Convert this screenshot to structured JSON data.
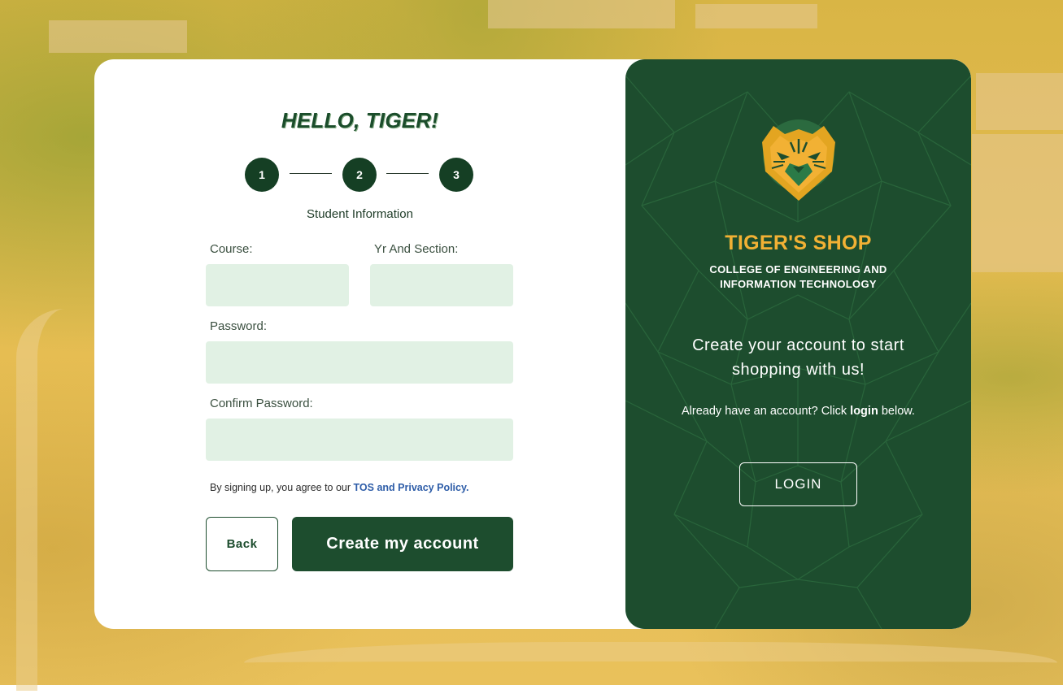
{
  "form": {
    "greeting": "HELLO, TIGER!",
    "steps": [
      "1",
      "2",
      "3"
    ],
    "step_label": "Student Information",
    "course_label": "Course:",
    "course_value": "",
    "yr_section_label": "Yr And Section:",
    "yr_section_value": "",
    "password_label": "Password:",
    "password_value": "",
    "confirm_password_label": "Confirm Password:",
    "confirm_password_value": "",
    "tos_prefix": "By signing up, you agree to our ",
    "tos_link": "TOS and Privacy Policy.",
    "back_label": "Back",
    "create_label": "Create my account"
  },
  "panel": {
    "brand": "TIGER'S SHOP",
    "college_line1": "COLLEGE OF ENGINEERING AND",
    "college_line2": "INFORMATION TECHNOLOGY",
    "tagline_line1": "Create your account to start",
    "tagline_line2": "shopping with us!",
    "already_prefix": "Already have an account? Click ",
    "already_link": "login",
    "already_suffix": " below.",
    "login_label": "LOGIN",
    "logo_icon": "tiger-head-icon"
  },
  "colors": {
    "brand_green": "#1d4d2e",
    "step_green": "#153f24",
    "accent_gold": "#f2b134",
    "input_bg": "#e1f1e4",
    "link_blue": "#2e5da8",
    "backdrop": "#e6bd52"
  }
}
